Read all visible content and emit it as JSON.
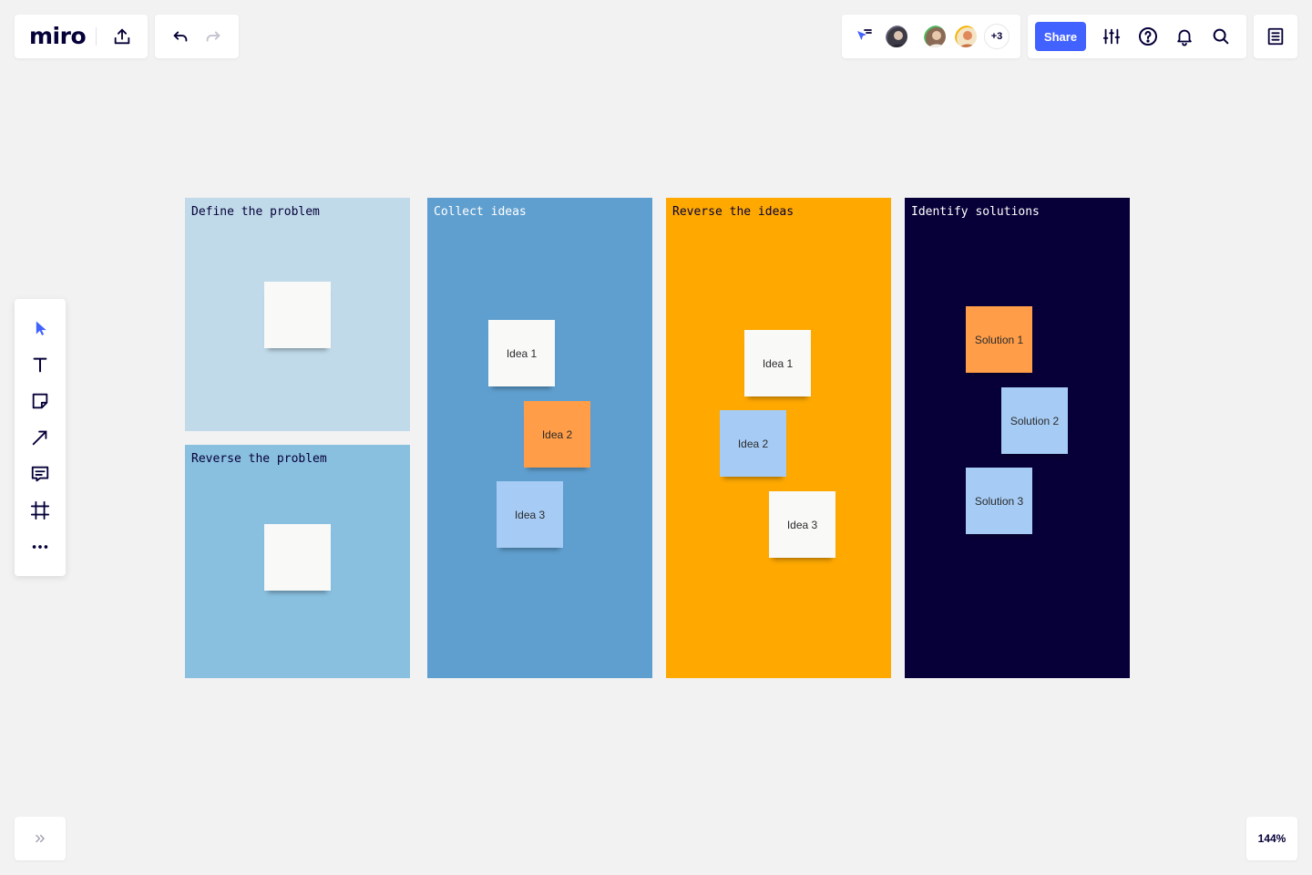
{
  "app": {
    "logo": "miro",
    "zoom": "144%"
  },
  "toolbar_top": {
    "share_label": "Share",
    "collaborators_more": "+3",
    "collaborators": [
      {
        "name": "avatar-1",
        "ring": "#5d5b6e",
        "fill": "#3b3a45"
      },
      {
        "name": "avatar-2",
        "ring": "#4fb65e",
        "fill": "#8a6a55"
      },
      {
        "name": "avatar-3",
        "ring": "#f5b400",
        "fill": "#c8734a"
      }
    ]
  },
  "icons": {
    "upload": "upload-icon",
    "undo": "undo-icon",
    "redo": "redo-icon",
    "cursor_follow": "follow-cursor-icon",
    "settings": "sliders-icon",
    "help": "help-icon",
    "notifications": "bell-icon",
    "search": "search-icon",
    "notes": "notes-icon",
    "expand": "chevron-double-right-icon"
  },
  "tools": [
    {
      "name": "select-tool",
      "icon": "cursor-icon",
      "active": true
    },
    {
      "name": "text-tool",
      "icon": "text-icon"
    },
    {
      "name": "sticky-note-tool",
      "icon": "sticky-note-icon"
    },
    {
      "name": "connector-tool",
      "icon": "arrow-icon"
    },
    {
      "name": "comment-tool",
      "icon": "comment-icon"
    },
    {
      "name": "frame-tool",
      "icon": "frame-icon"
    },
    {
      "name": "more-tools",
      "icon": "more-icon"
    }
  ],
  "colors": {
    "accent": "#4262ff",
    "define_problem": "#c0daea",
    "reverse_problem": "#89bfdf",
    "collect_ideas": "#5f9fcf",
    "reverse_ideas": "#fea800",
    "identify_solutions": "#070038"
  },
  "board": {
    "frames": {
      "define": {
        "title": "Define the problem"
      },
      "reverse_problem": {
        "title": "Reverse the problem"
      },
      "collect": {
        "title": "Collect ideas",
        "stickies": [
          "Idea 1",
          "Idea 2",
          "Idea 3"
        ]
      },
      "reverse_ideas": {
        "title": "Reverse the ideas",
        "stickies": [
          "Idea 1",
          "Idea 2",
          "Idea 3"
        ]
      },
      "solutions": {
        "title": "Identify solutions",
        "stickies": [
          "Solution 1",
          "Solution 2",
          "Solution 3"
        ]
      }
    }
  }
}
